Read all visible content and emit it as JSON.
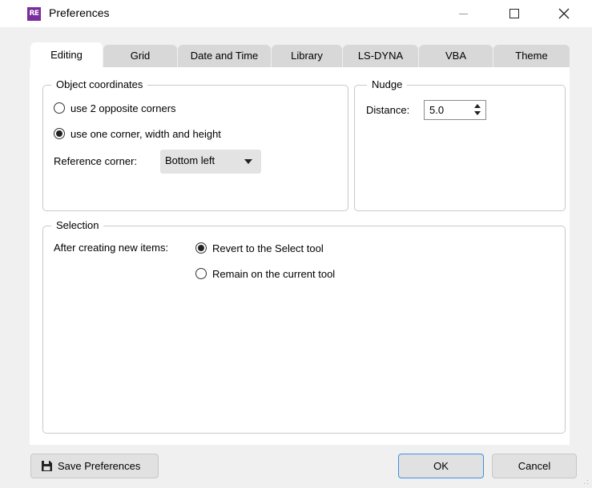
{
  "window": {
    "app_icon_text": "RE",
    "title": "Preferences"
  },
  "tabs": [
    {
      "label": "Editing",
      "active": true
    },
    {
      "label": "Grid",
      "active": false
    },
    {
      "label": "Date and Time",
      "active": false
    },
    {
      "label": "Library",
      "active": false
    },
    {
      "label": "LS-DYNA",
      "active": false
    },
    {
      "label": "VBA",
      "active": false
    },
    {
      "label": "Theme",
      "active": false
    }
  ],
  "object_coordinates": {
    "title": "Object coordinates",
    "options": [
      {
        "label": "use 2 opposite corners",
        "checked": false
      },
      {
        "label": "use one corner, width and height",
        "checked": true
      }
    ],
    "reference_label": "Reference corner:",
    "reference_value": "Bottom left"
  },
  "nudge": {
    "title": "Nudge",
    "distance_label": "Distance:",
    "distance_value": "5.0"
  },
  "selection": {
    "title": "Selection",
    "after_label": "After creating new items:",
    "options": [
      {
        "label": "Revert to the Select tool",
        "checked": true
      },
      {
        "label": "Remain on the current tool",
        "checked": false
      }
    ]
  },
  "buttons": {
    "save": "Save Preferences",
    "ok": "OK",
    "cancel": "Cancel"
  },
  "colors": {
    "app_icon": "#7a2d9c",
    "ok_border": "#3c8fe6"
  }
}
